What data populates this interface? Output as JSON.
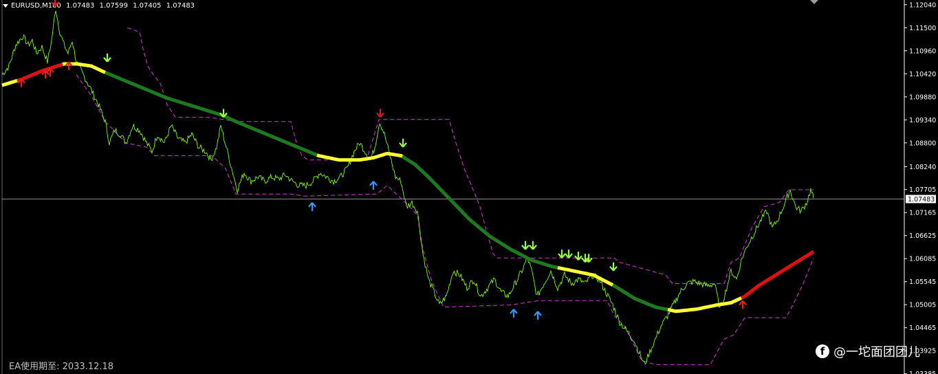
{
  "header": {
    "symbol": "EURUSD,M100",
    "open": "1.07483",
    "high": "1.07599",
    "low": "1.07405",
    "close": "1.07483"
  },
  "footer": {
    "ea_expiry": "EA使用期至: 2033.12.18"
  },
  "watermark": {
    "icon": "facebook-icon",
    "text": "@一坨面团团儿"
  },
  "colors": {
    "price": "#7CFC00",
    "ma_green": "#1E7A1E",
    "ma_yellow": "#FFFF33",
    "ma_red": "#E01010",
    "band": "#D040D0",
    "arrow_up_red": "#E02020",
    "arrow_up_blue": "#3399FF",
    "arrow_down_green": "#99FF44",
    "arrow_down_red": "#D02020",
    "axis_text": "#FFFFFF",
    "current_price_line": "#BBBBBB"
  },
  "chart_data": {
    "type": "line",
    "title": "",
    "xlabel": "",
    "ylabel": "",
    "ylim": [
      1.0338,
      1.1215
    ],
    "y_ticks": [
      "1.12040",
      "1.11500",
      "1.10960",
      "1.10420",
      "1.09880",
      "1.09340",
      "1.08800",
      "1.08240",
      "1.07705",
      "1.07165",
      "1.06625",
      "1.06085",
      "1.05545",
      "1.05005",
      "1.04465",
      "1.03925",
      "1.03385"
    ],
    "current_price": "1.07483",
    "x_range": [
      0,
      1180
    ],
    "price": {
      "name": "",
      "points": [
        [
          0,
          1.104
        ],
        [
          10,
          1.106
        ],
        [
          20,
          1.111
        ],
        [
          30,
          1.113
        ],
        [
          38,
          1.111
        ],
        [
          44,
          1.112
        ],
        [
          50,
          1.109
        ],
        [
          58,
          1.1105
        ],
        [
          66,
          1.107
        ],
        [
          72,
          1.112
        ],
        [
          78,
          1.1195
        ],
        [
          84,
          1.114
        ],
        [
          90,
          1.111
        ],
        [
          96,
          1.109
        ],
        [
          102,
          1.112
        ],
        [
          108,
          1.107
        ],
        [
          118,
          1.104
        ],
        [
          128,
          1.101
        ],
        [
          140,
          1.097
        ],
        [
          150,
          1.093
        ],
        [
          156,
          1.088
        ],
        [
          164,
          1.091
        ],
        [
          172,
          1.09
        ],
        [
          180,
          1.088
        ],
        [
          190,
          1.092
        ],
        [
          200,
          1.091
        ],
        [
          210,
          1.088
        ],
        [
          218,
          1.086
        ],
        [
          226,
          1.09
        ],
        [
          236,
          1.088
        ],
        [
          246,
          1.092
        ],
        [
          256,
          1.089
        ],
        [
          266,
          1.088
        ],
        [
          276,
          1.09
        ],
        [
          286,
          1.087
        ],
        [
          296,
          1.086
        ],
        [
          304,
          1.084
        ],
        [
          312,
          1.087
        ],
        [
          318,
          1.092
        ],
        [
          326,
          1.087
        ],
        [
          334,
          1.082
        ],
        [
          342,
          1.077
        ],
        [
          352,
          1.081
        ],
        [
          362,
          1.079
        ],
        [
          372,
          1.08
        ],
        [
          382,
          1.079
        ],
        [
          392,
          1.08
        ],
        [
          402,
          1.0795
        ],
        [
          412,
          1.0805
        ],
        [
          422,
          1.079
        ],
        [
          432,
          1.078
        ],
        [
          442,
          1.078
        ],
        [
          452,
          1.079
        ],
        [
          462,
          1.081
        ],
        [
          472,
          1.08
        ],
        [
          482,
          1.079
        ],
        [
          492,
          1.08
        ],
        [
          502,
          1.082
        ],
        [
          512,
          1.086
        ],
        [
          520,
          1.088
        ],
        [
          528,
          1.086
        ],
        [
          536,
          1.084
        ],
        [
          542,
          1.087
        ],
        [
          549,
          1.093
        ],
        [
          556,
          1.09
        ],
        [
          564,
          1.085
        ],
        [
          572,
          1.08
        ],
        [
          580,
          1.079
        ],
        [
          588,
          1.073
        ],
        [
          596,
          1.074
        ],
        [
          604,
          1.072
        ],
        [
          612,
          1.062
        ],
        [
          620,
          1.056
        ],
        [
          628,
          1.053
        ],
        [
          636,
          1.05
        ],
        [
          646,
          1.052
        ],
        [
          656,
          1.058
        ],
        [
          666,
          1.057
        ],
        [
          676,
          1.054
        ],
        [
          686,
          1.056
        ],
        [
          696,
          1.052
        ],
        [
          706,
          1.054
        ],
        [
          716,
          1.056
        ],
        [
          726,
          1.053
        ],
        [
          736,
          1.052
        ],
        [
          746,
          1.055
        ],
        [
          756,
          1.058
        ],
        [
          764,
          1.061
        ],
        [
          770,
          1.058
        ],
        [
          778,
          1.052
        ],
        [
          788,
          1.055
        ],
        [
          798,
          1.058
        ],
        [
          808,
          1.054
        ],
        [
          818,
          1.057
        ],
        [
          828,
          1.055
        ],
        [
          838,
          1.056
        ],
        [
          848,
          1.055
        ],
        [
          858,
          1.057
        ],
        [
          868,
          1.056
        ],
        [
          878,
          1.053
        ],
        [
          888,
          1.05
        ],
        [
          898,
          1.046
        ],
        [
          908,
          1.044
        ],
        [
          918,
          1.042
        ],
        [
          926,
          1.039
        ],
        [
          934,
          1.036
        ],
        [
          942,
          1.039
        ],
        [
          950,
          1.042
        ],
        [
          958,
          1.045
        ],
        [
          966,
          1.047
        ],
        [
          976,
          1.05
        ],
        [
          986,
          1.053
        ],
        [
          996,
          1.055
        ],
        [
          1006,
          1.0555
        ],
        [
          1016,
          1.055
        ],
        [
          1026,
          1.0545
        ],
        [
          1036,
          1.055
        ],
        [
          1044,
          1.049
        ],
        [
          1052,
          1.053
        ],
        [
          1060,
          1.058
        ],
        [
          1068,
          1.056
        ],
        [
          1076,
          1.061
        ],
        [
          1084,
          1.064
        ],
        [
          1094,
          1.067
        ],
        [
          1104,
          1.07
        ],
        [
          1112,
          1.072
        ],
        [
          1120,
          1.068
        ],
        [
          1128,
          1.07
        ],
        [
          1136,
          1.073
        ],
        [
          1146,
          1.077
        ],
        [
          1154,
          1.073
        ],
        [
          1162,
          1.072
        ],
        [
          1170,
          1.074
        ],
        [
          1176,
          1.077
        ],
        [
          1180,
          1.075
        ]
      ]
    },
    "moving_average": {
      "name": "",
      "points": [
        [
          0,
          1.1015
        ],
        [
          30,
          1.103
        ],
        [
          60,
          1.105
        ],
        [
          90,
          1.1065
        ],
        [
          110,
          1.1065
        ],
        [
          130,
          1.106
        ],
        [
          150,
          1.1045
        ],
        [
          180,
          1.1025
        ],
        [
          210,
          1.1005
        ],
        [
          240,
          1.0985
        ],
        [
          270,
          1.097
        ],
        [
          300,
          1.0955
        ],
        [
          320,
          1.0945
        ],
        [
          340,
          1.093
        ],
        [
          370,
          1.091
        ],
        [
          400,
          1.089
        ],
        [
          430,
          1.087
        ],
        [
          460,
          1.085
        ],
        [
          490,
          1.084
        ],
        [
          520,
          1.084
        ],
        [
          540,
          1.0845
        ],
        [
          560,
          1.0855
        ],
        [
          580,
          1.085
        ],
        [
          600,
          1.083
        ],
        [
          620,
          1.08
        ],
        [
          650,
          1.075
        ],
        [
          680,
          1.07
        ],
        [
          710,
          1.066
        ],
        [
          740,
          1.063
        ],
        [
          770,
          1.0605
        ],
        [
          800,
          1.059
        ],
        [
          830,
          1.058
        ],
        [
          860,
          1.057
        ],
        [
          890,
          1.0545
        ],
        [
          920,
          1.0515
        ],
        [
          950,
          1.0495
        ],
        [
          980,
          1.0485
        ],
        [
          1010,
          1.049
        ],
        [
          1040,
          1.05
        ],
        [
          1060,
          1.0505
        ],
        [
          1080,
          1.052
        ],
        [
          1100,
          1.0545
        ],
        [
          1130,
          1.0575
        ],
        [
          1160,
          1.0605
        ],
        [
          1180,
          1.0625
        ]
      ],
      "color_segments": [
        {
          "from": 0,
          "to": 22,
          "color": "yellow"
        },
        {
          "from": 22,
          "to": 88,
          "color": "red"
        },
        {
          "from": 88,
          "to": 150,
          "color": "yellow"
        },
        {
          "from": 150,
          "to": 458,
          "color": "green"
        },
        {
          "from": 458,
          "to": 582,
          "color": "yellow"
        },
        {
          "from": 582,
          "to": 808,
          "color": "green"
        },
        {
          "from": 808,
          "to": 888,
          "color": "yellow"
        },
        {
          "from": 888,
          "to": 968,
          "color": "green"
        },
        {
          "from": 968,
          "to": 1075,
          "color": "yellow"
        },
        {
          "from": 1075,
          "to": 1180,
          "color": "red"
        }
      ]
    },
    "upper_band": {
      "name": "",
      "points": [
        [
          182,
          1.115
        ],
        [
          200,
          1.114
        ],
        [
          205,
          1.11
        ],
        [
          212,
          1.106
        ],
        [
          220,
          1.104
        ],
        [
          230,
          1.102
        ],
        [
          240,
          1.097
        ],
        [
          252,
          1.094
        ],
        [
          300,
          1.094
        ],
        [
          342,
          1.093
        ],
        [
          420,
          1.093
        ],
        [
          428,
          1.088
        ],
        [
          436,
          1.085
        ],
        [
          445,
          1.084
        ],
        [
          530,
          1.084
        ],
        [
          548,
          1.0935
        ],
        [
          650,
          1.0935
        ],
        [
          660,
          1.088
        ],
        [
          672,
          1.082
        ],
        [
          685,
          1.077
        ],
        [
          695,
          1.073
        ],
        [
          705,
          1.067
        ],
        [
          714,
          1.062
        ],
        [
          720,
          1.061
        ],
        [
          890,
          1.061
        ],
        [
          898,
          1.06
        ],
        [
          965,
          1.057
        ],
        [
          975,
          1.055
        ],
        [
          1050,
          1.055
        ],
        [
          1060,
          1.06
        ],
        [
          1072,
          1.061
        ],
        [
          1090,
          1.068
        ],
        [
          1108,
          1.073
        ],
        [
          1130,
          1.074
        ],
        [
          1144,
          1.077
        ],
        [
          1180,
          1.077
        ]
      ]
    },
    "lower_band": {
      "name": "",
      "points": [
        [
          108,
          1.104
        ],
        [
          130,
          1.099
        ],
        [
          150,
          1.093
        ],
        [
          180,
          1.088
        ],
        [
          210,
          1.087
        ],
        [
          222,
          1.085
        ],
        [
          235,
          1.085
        ],
        [
          305,
          1.085
        ],
        [
          325,
          1.082
        ],
        [
          340,
          1.076
        ],
        [
          355,
          1.076
        ],
        [
          420,
          1.076
        ],
        [
          440,
          1.0755
        ],
        [
          545,
          1.076
        ],
        [
          560,
          1.078
        ],
        [
          590,
          1.0735
        ],
        [
          604,
          1.071
        ],
        [
          612,
          1.063
        ],
        [
          624,
          1.056
        ],
        [
          632,
          1.053
        ],
        [
          642,
          1.0495
        ],
        [
          740,
          1.05
        ],
        [
          780,
          1.051
        ],
        [
          880,
          1.051
        ],
        [
          890,
          1.0475
        ],
        [
          905,
          1.045
        ],
        [
          930,
          1.037
        ],
        [
          950,
          1.036
        ],
        [
          1030,
          1.036
        ],
        [
          1040,
          1.039
        ],
        [
          1050,
          1.042
        ],
        [
          1064,
          1.043
        ],
        [
          1080,
          1.047
        ],
        [
          1140,
          1.047
        ],
        [
          1150,
          1.05
        ],
        [
          1165,
          1.055
        ],
        [
          1180,
          1.061
        ]
      ]
    },
    "signals_up_red": [
      [
        28,
        1.102
      ],
      [
        63,
        1.104
      ],
      [
        70,
        1.1045
      ],
      [
        97,
        1.106
      ],
      [
        1077,
        1.05
      ]
    ],
    "signals_up_blue": [
      [
        451,
        1.073
      ],
      [
        540,
        1.078
      ],
      [
        744,
        1.048
      ],
      [
        779,
        1.0475
      ]
    ],
    "signals_down_green": [
      [
        153,
        1.108
      ],
      [
        322,
        1.095
      ],
      [
        583,
        1.088
      ],
      [
        761,
        1.064
      ],
      [
        772,
        1.064
      ],
      [
        814,
        1.062
      ],
      [
        824,
        1.062
      ],
      [
        838,
        1.0615
      ],
      [
        848,
        1.061
      ],
      [
        853,
        1.061
      ],
      [
        889,
        1.059
      ]
    ],
    "signals_down_red": [
      [
        77,
        1.121
      ],
      [
        550,
        1.095
      ]
    ]
  }
}
